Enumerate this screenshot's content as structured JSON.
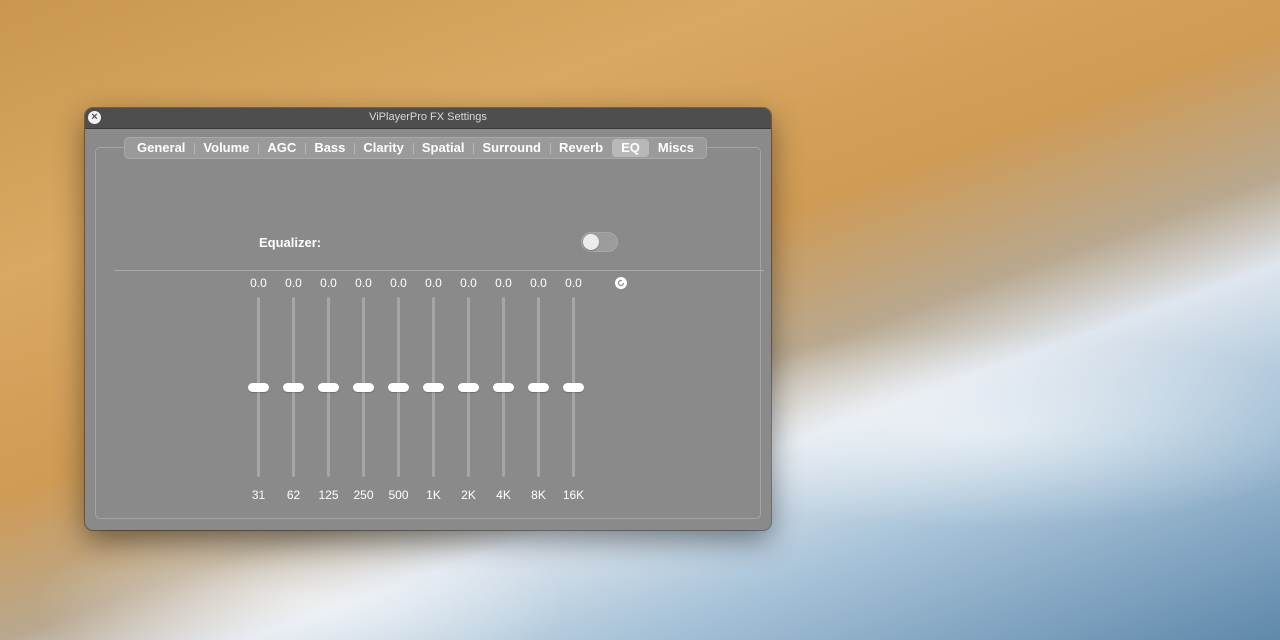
{
  "window": {
    "title": "ViPlayerPro FX Settings",
    "tabs": [
      {
        "label": "General"
      },
      {
        "label": "Volume"
      },
      {
        "label": "AGC"
      },
      {
        "label": "Bass"
      },
      {
        "label": "Clarity"
      },
      {
        "label": "Spatial"
      },
      {
        "label": "Surround"
      },
      {
        "label": "Reverb"
      },
      {
        "label": "EQ"
      },
      {
        "label": "Miscs"
      }
    ],
    "active_tab": "EQ"
  },
  "eq": {
    "label": "Equalizer:",
    "enabled": false,
    "bands": [
      {
        "freq": "31",
        "value": "0.0"
      },
      {
        "freq": "62",
        "value": "0.0"
      },
      {
        "freq": "125",
        "value": "0.0"
      },
      {
        "freq": "250",
        "value": "0.0"
      },
      {
        "freq": "500",
        "value": "0.0"
      },
      {
        "freq": "1K",
        "value": "0.0"
      },
      {
        "freq": "2K",
        "value": "0.0"
      },
      {
        "freq": "4K",
        "value": "0.0"
      },
      {
        "freq": "8K",
        "value": "0.0"
      },
      {
        "freq": "16K",
        "value": "0.0"
      }
    ],
    "slider_range": [
      -12,
      12
    ],
    "reset_icon": "reset-icon"
  }
}
